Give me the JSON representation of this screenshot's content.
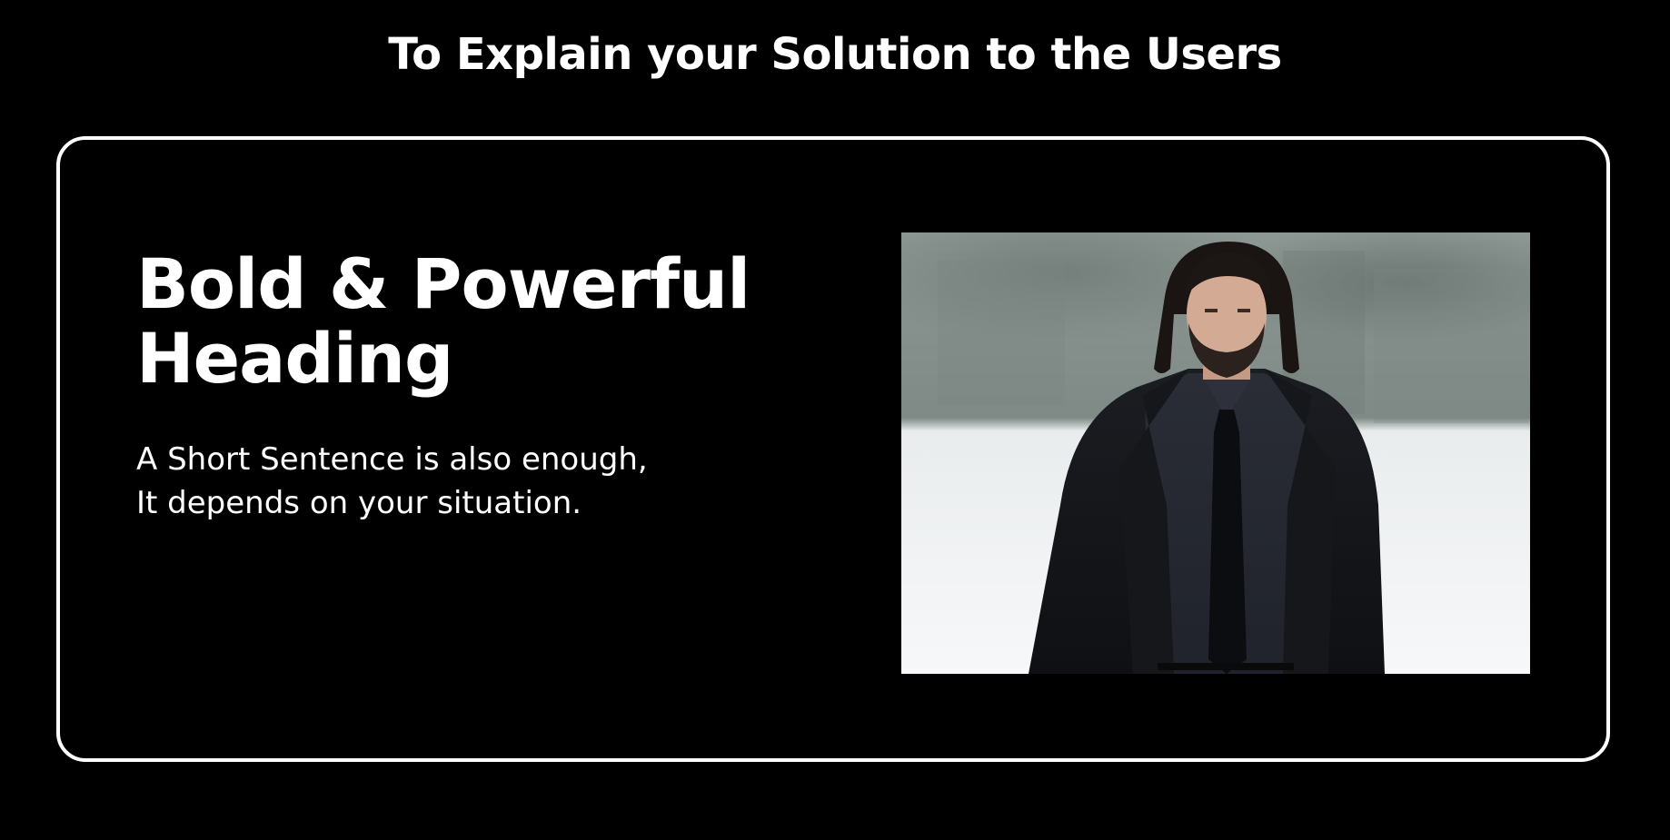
{
  "page": {
    "title": "To Explain your Solution to the Users"
  },
  "card": {
    "heading_line1": "Bold & Powerful",
    "heading_line2": "Heading",
    "subtext_line1": "A Short Sentence is also enough,",
    "subtext_line2": "It depends on your situation."
  },
  "colors": {
    "background": "#000000",
    "text": "#ffffff",
    "card_border": "#ffffff"
  }
}
